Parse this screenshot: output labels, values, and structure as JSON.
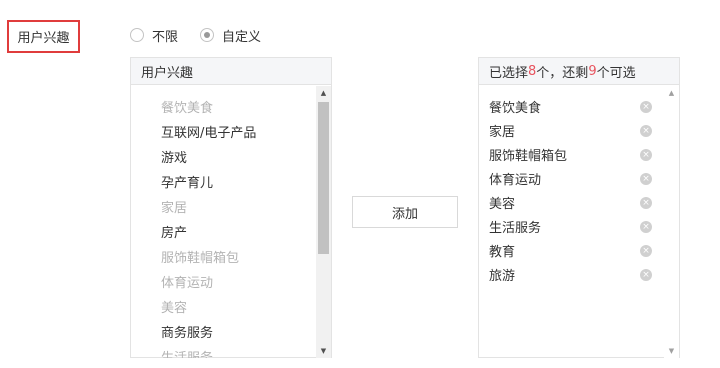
{
  "field": {
    "label": "用户兴趣"
  },
  "radios": [
    {
      "label": "不限",
      "checked": false
    },
    {
      "label": "自定义",
      "checked": true
    }
  ],
  "left_panel": {
    "title": "用户兴趣",
    "items": [
      {
        "label": "餐饮美食",
        "disabled": true
      },
      {
        "label": "互联网/电子产品",
        "disabled": false
      },
      {
        "label": "游戏",
        "disabled": false
      },
      {
        "label": "孕产育儿",
        "disabled": false
      },
      {
        "label": "家居",
        "disabled": true
      },
      {
        "label": "房产",
        "disabled": false
      },
      {
        "label": "服饰鞋帽箱包",
        "disabled": true
      },
      {
        "label": "体育运动",
        "disabled": true
      },
      {
        "label": "美容",
        "disabled": true
      },
      {
        "label": "商务服务",
        "disabled": false
      },
      {
        "label": "生活服务",
        "disabled": true
      }
    ]
  },
  "add_button": {
    "label": "添加"
  },
  "right_panel": {
    "header_prefix": "已选择",
    "selected_count": "8",
    "header_middle": "个，还剩",
    "remaining_count": "9",
    "header_suffix": "个可选",
    "items": [
      "餐饮美食",
      "家居",
      "服饰鞋帽箱包",
      "体育运动",
      "美容",
      "生活服务",
      "教育",
      "旅游"
    ]
  },
  "colors": {
    "highlight_border": "#e03c3c",
    "count": "#e8545f",
    "disabled_text": "#b3b3b3"
  }
}
